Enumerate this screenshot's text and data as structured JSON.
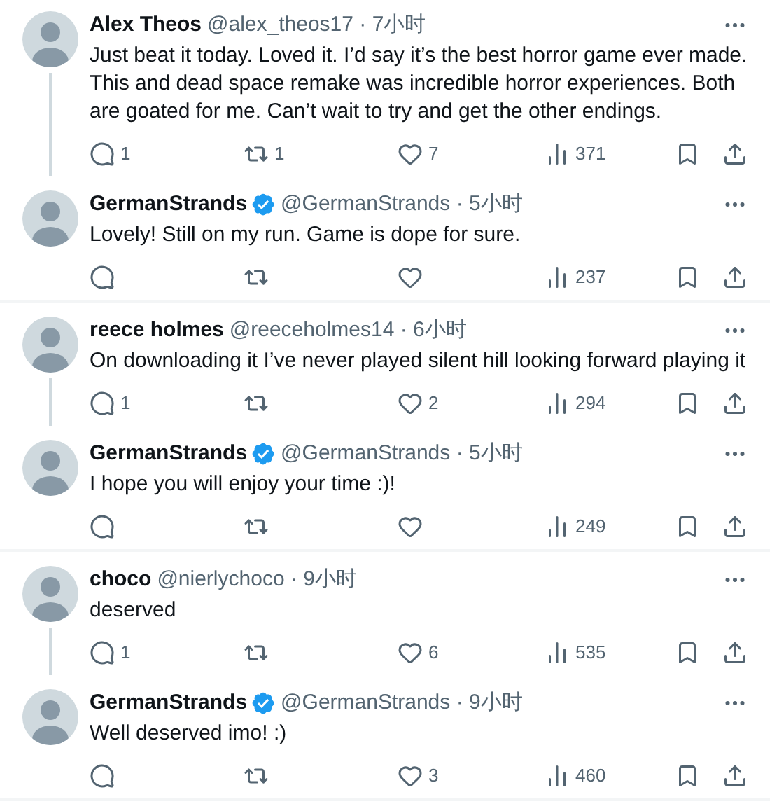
{
  "threads": [
    {
      "tweets": [
        {
          "name": "Alex Theos",
          "verified": false,
          "meta": "@alex_theos17 · 7小时",
          "text": "Just beat it today. Loved it. I’d say it’s the best horror game ever made. This and dead space remake was incredible horror experiences. Both are goated for me. Can’t wait to try and get the other endings.",
          "replies": "1",
          "reposts": "1",
          "likes": "7",
          "views": "371"
        },
        {
          "name": "GermanStrands",
          "verified": true,
          "meta": "@GermanStrands · 5小时",
          "text": "Lovely! Still on my run. Game is dope for sure.",
          "views": "237"
        }
      ]
    },
    {
      "tweets": [
        {
          "name": "reece holmes",
          "verified": false,
          "meta": "@reeceholmes14 · 6小时",
          "text": "On downloading it I’ve never played silent hill looking forward playing it",
          "replies": "1",
          "likes": "2",
          "views": "294"
        },
        {
          "name": "GermanStrands",
          "verified": true,
          "meta": "@GermanStrands · 5小时",
          "text": "I hope you will enjoy your time :)!",
          "views": "249"
        }
      ]
    },
    {
      "tweets": [
        {
          "name": "choco",
          "verified": false,
          "meta": "@nierlychoco · 9小时",
          "text": "deserved",
          "replies": "1",
          "likes": "6",
          "views": "535"
        },
        {
          "name": "GermanStrands",
          "verified": true,
          "meta": "@GermanStrands · 9小时",
          "text": "Well deserved imo! :)",
          "likes": "3",
          "views": "460"
        }
      ]
    }
  ]
}
